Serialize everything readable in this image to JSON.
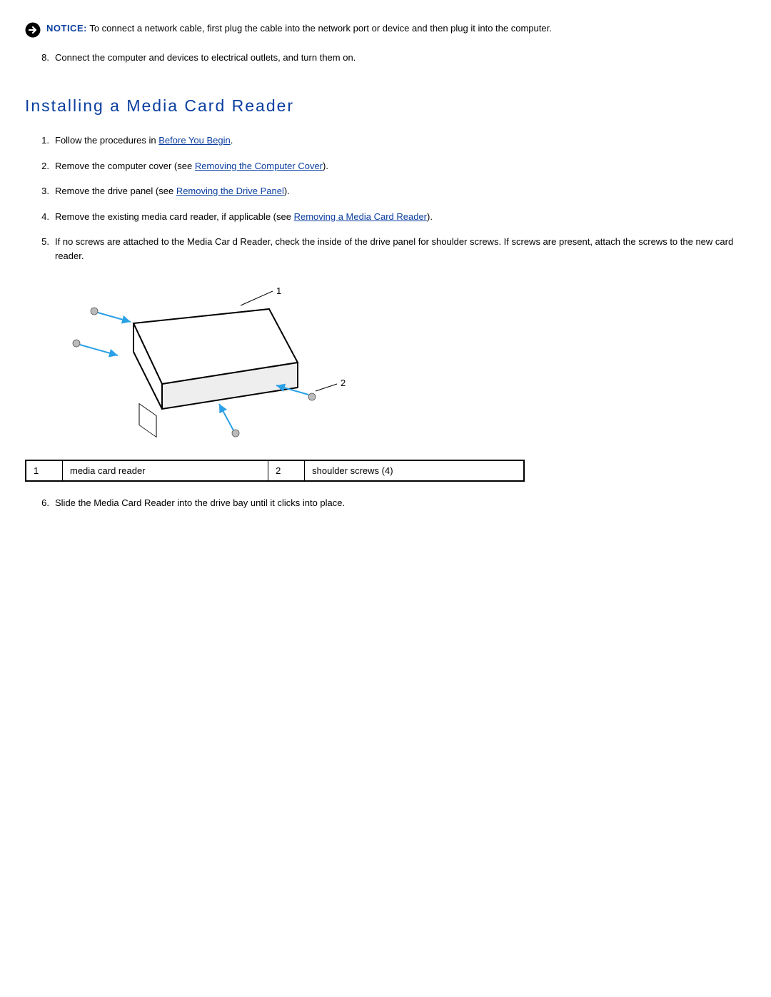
{
  "notice": {
    "label": "NOTICE:",
    "text": " To connect a network cable, first plug the cable into the network port or device and then plug it into the computer."
  },
  "top_steps": [
    {
      "num": "8.",
      "text": "Connect the computer and devices to electrical outlets, and turn them on."
    }
  ],
  "section_title": "Installing a Media Card Reader",
  "steps": [
    {
      "num": "1.",
      "pre": "Follow the procedures in ",
      "link": "Before You Begin",
      "post": "."
    },
    {
      "num": "2.",
      "pre": "Remove the computer cover (see ",
      "link": "Removing the Computer Cover",
      "post": ")."
    },
    {
      "num": "3.",
      "pre": "Remove the drive panel (see ",
      "link": "Removing the Drive Panel",
      "post": ")."
    },
    {
      "num": "4.",
      "pre": "Remove the existing media card reader, if applicable (see ",
      "link": "Removing a Media Card Reader",
      "post": ")."
    },
    {
      "num": "5.",
      "pre": "If no screws are attached to the Media Car d Reader, check the inside of the drive panel for shoulder screws. If screws are present, attach the screws to the new card reader.",
      "link": "",
      "post": ""
    }
  ],
  "diagram": {
    "label1": "1",
    "label2": "2"
  },
  "callouts": {
    "c1_num": "1",
    "c1_text": "media card reader",
    "c2_num": "2",
    "c2_text": "shoulder screws (4)"
  },
  "after_steps": [
    {
      "num": "6.",
      "text": "Slide the Media Card Reader into the drive bay until it clicks into place."
    }
  ]
}
